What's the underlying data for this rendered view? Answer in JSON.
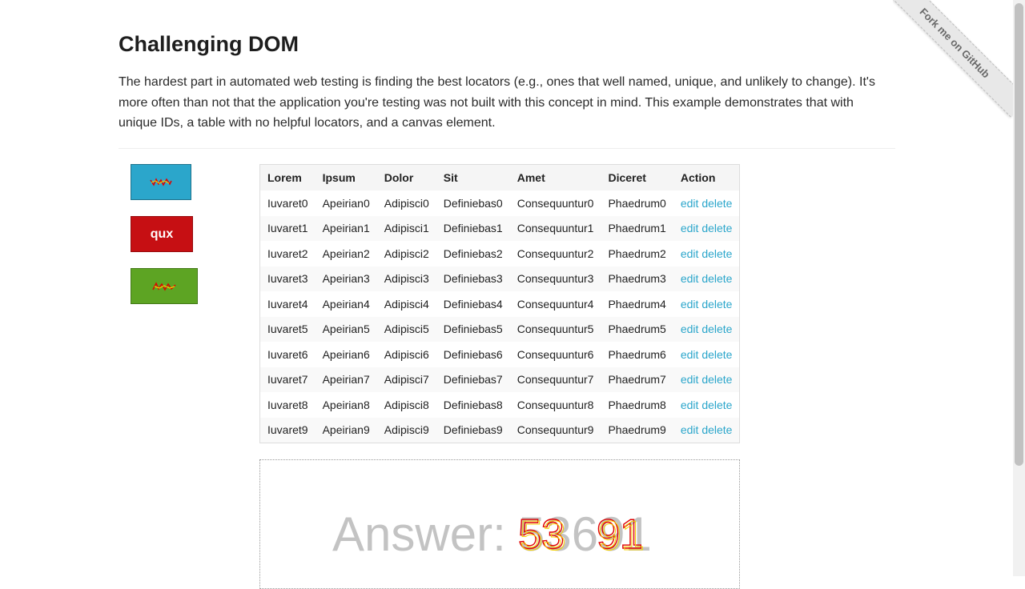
{
  "page": {
    "title": "Challenging DOM",
    "description": "The hardest part in automated web testing is finding the best locators (e.g., ones that well named, unique, and unlikely to change). It's more often than not that the application you're testing was not built with this concept in mind. This example demonstrates that with unique IDs, a table with no helpful locators, and a canvas element."
  },
  "ribbon": {
    "label": "Fork me on GitHub"
  },
  "buttons": [
    {
      "label": "foo",
      "variant": "primary",
      "color": "#2ba6cb"
    },
    {
      "label": "qux",
      "variant": "alert",
      "color": "#c60f13"
    },
    {
      "label": "baz",
      "variant": "success",
      "color": "#5da423"
    }
  ],
  "table": {
    "headers": [
      "Lorem",
      "Ipsum",
      "Dolor",
      "Sit",
      "Amet",
      "Diceret",
      "Action"
    ],
    "rows": [
      [
        "Iuvaret0",
        "Apeirian0",
        "Adipisci0",
        "Definiebas0",
        "Consequuntur0",
        "Phaedrum0"
      ],
      [
        "Iuvaret1",
        "Apeirian1",
        "Adipisci1",
        "Definiebas1",
        "Consequuntur1",
        "Phaedrum1"
      ],
      [
        "Iuvaret2",
        "Apeirian2",
        "Adipisci2",
        "Definiebas2",
        "Consequuntur2",
        "Phaedrum2"
      ],
      [
        "Iuvaret3",
        "Apeirian3",
        "Adipisci3",
        "Definiebas3",
        "Consequuntur3",
        "Phaedrum3"
      ],
      [
        "Iuvaret4",
        "Apeirian4",
        "Adipisci4",
        "Definiebas4",
        "Consequuntur4",
        "Phaedrum4"
      ],
      [
        "Iuvaret5",
        "Apeirian5",
        "Adipisci5",
        "Definiebas5",
        "Consequuntur5",
        "Phaedrum5"
      ],
      [
        "Iuvaret6",
        "Apeirian6",
        "Adipisci6",
        "Definiebas6",
        "Consequuntur6",
        "Phaedrum6"
      ],
      [
        "Iuvaret7",
        "Apeirian7",
        "Adipisci7",
        "Definiebas7",
        "Consequuntur7",
        "Phaedrum7"
      ],
      [
        "Iuvaret8",
        "Apeirian8",
        "Adipisci8",
        "Definiebas8",
        "Consequuntur8",
        "Phaedrum8"
      ],
      [
        "Iuvaret9",
        "Apeirian9",
        "Adipisci9",
        "Definiebas9",
        "Consequuntur9",
        "Phaedrum9"
      ]
    ],
    "edit_label": "edit",
    "delete_label": "delete"
  },
  "canvas": {
    "answer_prefix": "Answer:",
    "answer_value": "53691",
    "text_color": "#c3c3c3",
    "overlay_color": "#e00000",
    "overlay_highlight": "#f5d000"
  },
  "colors": {
    "link": "#2ba6cb",
    "primary": "#2ba6cb",
    "alert": "#c60f13",
    "success": "#5da423"
  }
}
